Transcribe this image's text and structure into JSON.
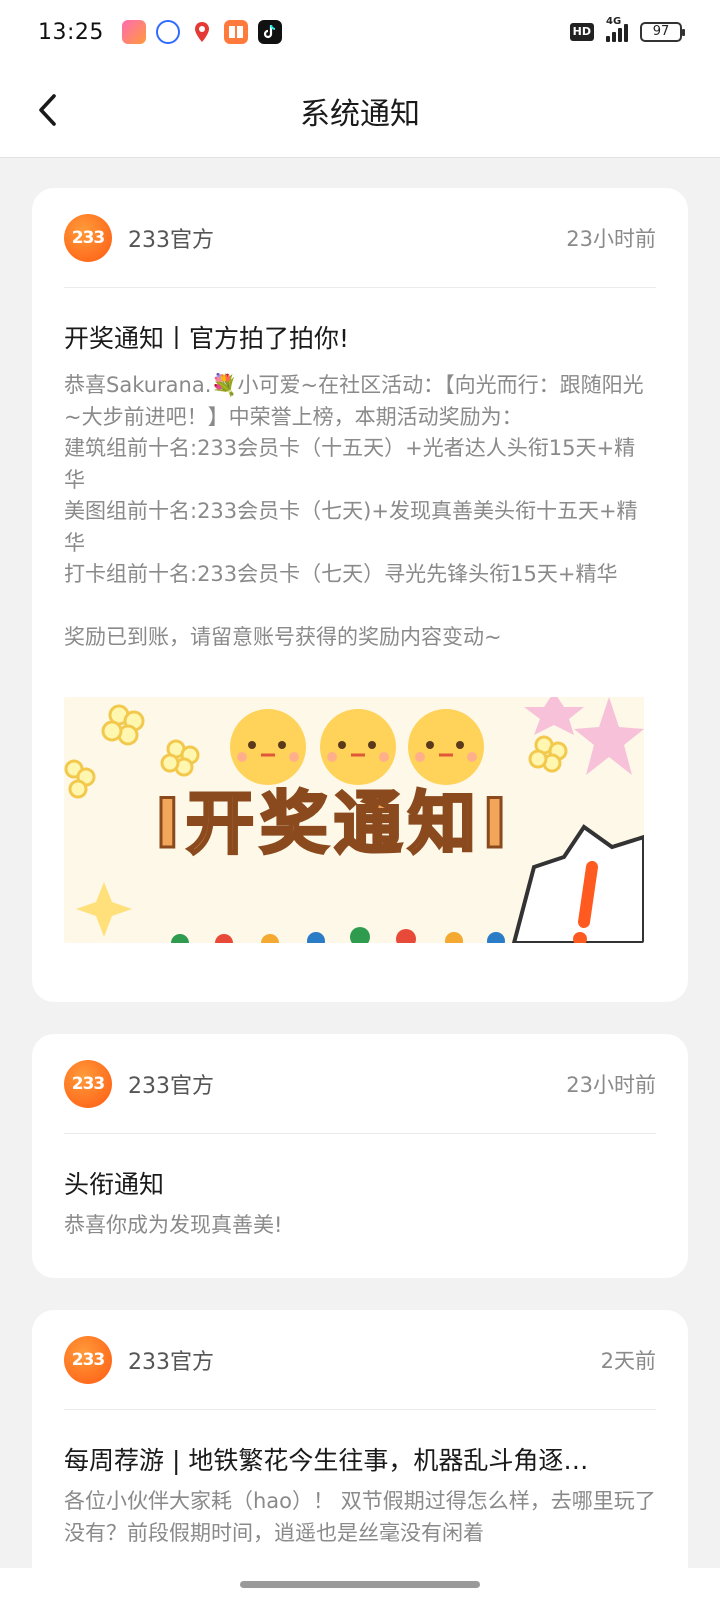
{
  "status_bar": {
    "time": "13:25",
    "network": "4G",
    "hd_label": "HD",
    "battery": "97"
  },
  "header": {
    "title": "系统通知",
    "back_icon": "chevron-left-icon"
  },
  "notifications": [
    {
      "logo_text": "233",
      "sender": "233官方",
      "time": "23小时前",
      "title": "开奖通知丨官方拍了拍你!",
      "body_lines": [
        "恭喜Sakurana.💐小可爱~在社区活动：【向光而行：跟随阳光~大步前进吧！】中荣誉上榜，本期活动奖励为：",
        "建筑组前十名:233会员卡（十五天）+光者达人头衔15天+精华",
        "美图组前十名:233会员卡（七天)+发现真善美头衔十五天+精华",
        "打卡组前十名:233会员卡（七天）寻光先锋头衔15天+精华"
      ],
      "body_footer": "奖励已到账，请留意账号获得的奖励内容变动~",
      "banner_text": "I开奖通知I"
    },
    {
      "logo_text": "233",
      "sender": "233官方",
      "time": "23小时前",
      "title": "头衔通知",
      "body": "恭喜你成为发现真善美!"
    },
    {
      "logo_text": "233",
      "sender": "233官方",
      "time": "2天前",
      "title": "每周荐游 | 地铁繁花今生往事，机器乱斗角逐…",
      "body": "各位小伙伴大家耗（hao）！ 双节假期过得怎么样，去哪里玩了没有？前段假期时间，逍遥也是丝毫没有闲着"
    }
  ],
  "colors": {
    "accent": "#ff6a1a",
    "background": "#f2f2f2",
    "card": "#ffffff",
    "muted_text": "#8a8a8a"
  }
}
